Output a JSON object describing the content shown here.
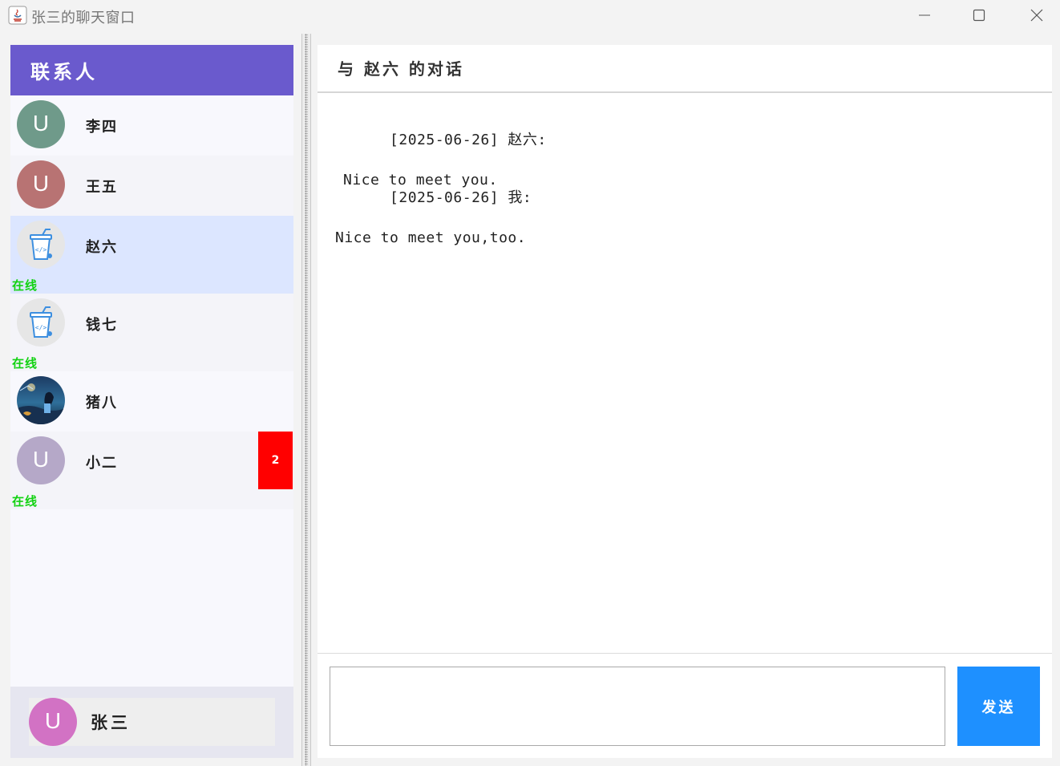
{
  "window": {
    "title": "张三的聊天窗口",
    "controls": [
      "minimize-icon",
      "maximize-icon",
      "close-icon"
    ]
  },
  "sidebar": {
    "header": "联系人",
    "contacts": [
      {
        "name": "李四",
        "avatar": "U",
        "avatar_color": "#6f9a8a",
        "online": "",
        "unread": ""
      },
      {
        "name": "王五",
        "avatar": "U",
        "avatar_color": "#b87373",
        "online": "",
        "unread": ""
      },
      {
        "name": "赵六",
        "avatar": "cup-icon",
        "avatar_color": "#e6e6e6",
        "online": "在线",
        "unread": ""
      },
      {
        "name": "钱七",
        "avatar": "cup-icon",
        "avatar_color": "#e6e6e6",
        "online": "在线",
        "unread": ""
      },
      {
        "name": "猪八",
        "avatar": "photo-avatar",
        "avatar_color": "#2a4a6a",
        "online": "",
        "unread": ""
      },
      {
        "name": "小二",
        "avatar": "U",
        "avatar_color": "#b5a8c8",
        "online": "在线",
        "unread": "2"
      }
    ],
    "self": {
      "name": "张三",
      "avatar": "U",
      "avatar_color": "#d272c4"
    }
  },
  "chat": {
    "title": "与 赵六 的对话",
    "messages": [
      {
        "header": "[2025-06-26] 赵六:",
        "body": "Nice to meet you."
      },
      {
        "header": "[2025-06-26] 我:",
        "body": "Nice to meet you,too."
      }
    ],
    "input_value": "",
    "send_label": "发送"
  },
  "colors": {
    "header_purple": "#6a5acd",
    "selected_row": "#dce6ff",
    "online_green": "#12d212",
    "unread_red": "#ff0000",
    "send_blue": "#1e90ff"
  }
}
